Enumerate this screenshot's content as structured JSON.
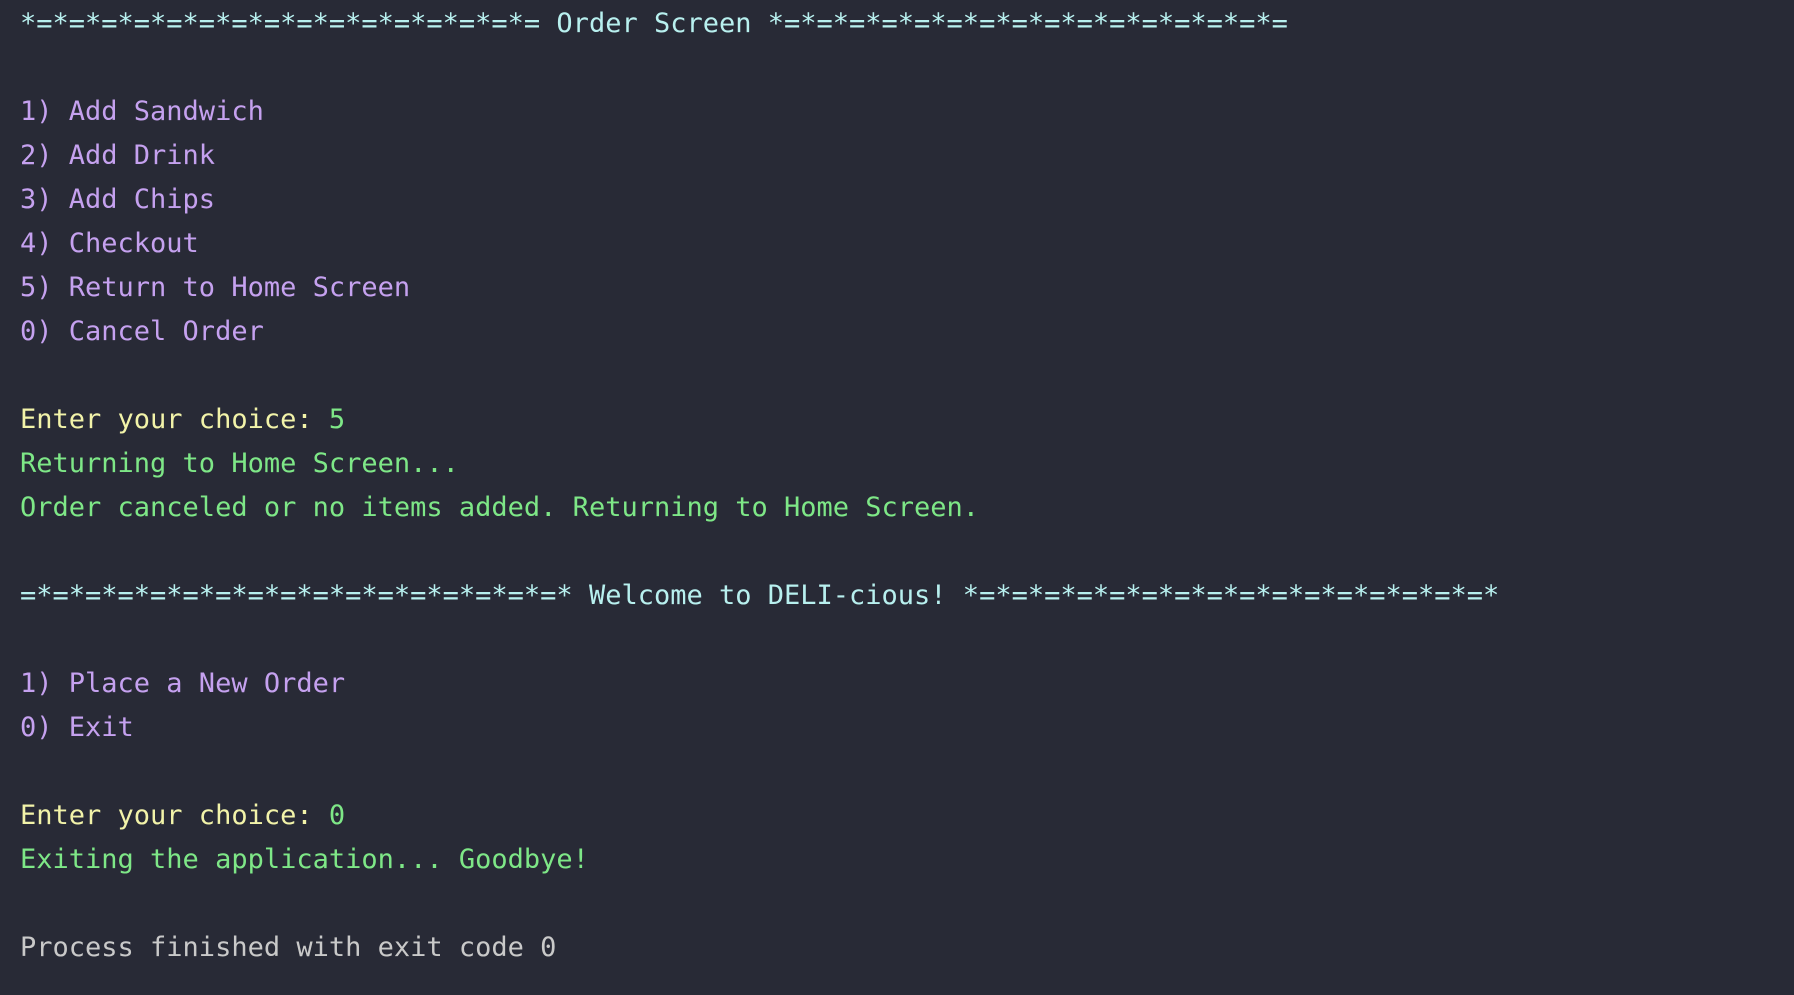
{
  "colors": {
    "background": "#282a36",
    "banner": "#b8f0ef",
    "menu": "#c5a1ef",
    "prompt": "#f2f3a9",
    "output": "#7ee787",
    "process": "#c9c9c9"
  },
  "order_screen": {
    "banner": "*=*=*=*=*=*=*=*=*=*=*=*=*=*=*=*= Order Screen *=*=*=*=*=*=*=*=*=*=*=*=*=*=*=*=",
    "options": [
      "1) Add Sandwich",
      "2) Add Drink",
      "3) Add Chips",
      "4) Checkout",
      "5) Return to Home Screen",
      "0) Cancel Order"
    ],
    "prompt": "Enter your choice: ",
    "choice": "5",
    "messages": [
      "Returning to Home Screen...",
      "Order canceled or no items added. Returning to Home Screen."
    ]
  },
  "home_screen": {
    "banner": "=*=*=*=*=*=*=*=*=*=*=*=*=*=*=*=*=* Welcome to DELI-cious! *=*=*=*=*=*=*=*=*=*=*=*=*=*=*=*=*",
    "options": [
      "1) Place a New Order",
      "0) Exit"
    ],
    "prompt": "Enter your choice: ",
    "choice": "0",
    "messages": [
      "Exiting the application... Goodbye!"
    ]
  },
  "process_status": "Process finished with exit code 0"
}
